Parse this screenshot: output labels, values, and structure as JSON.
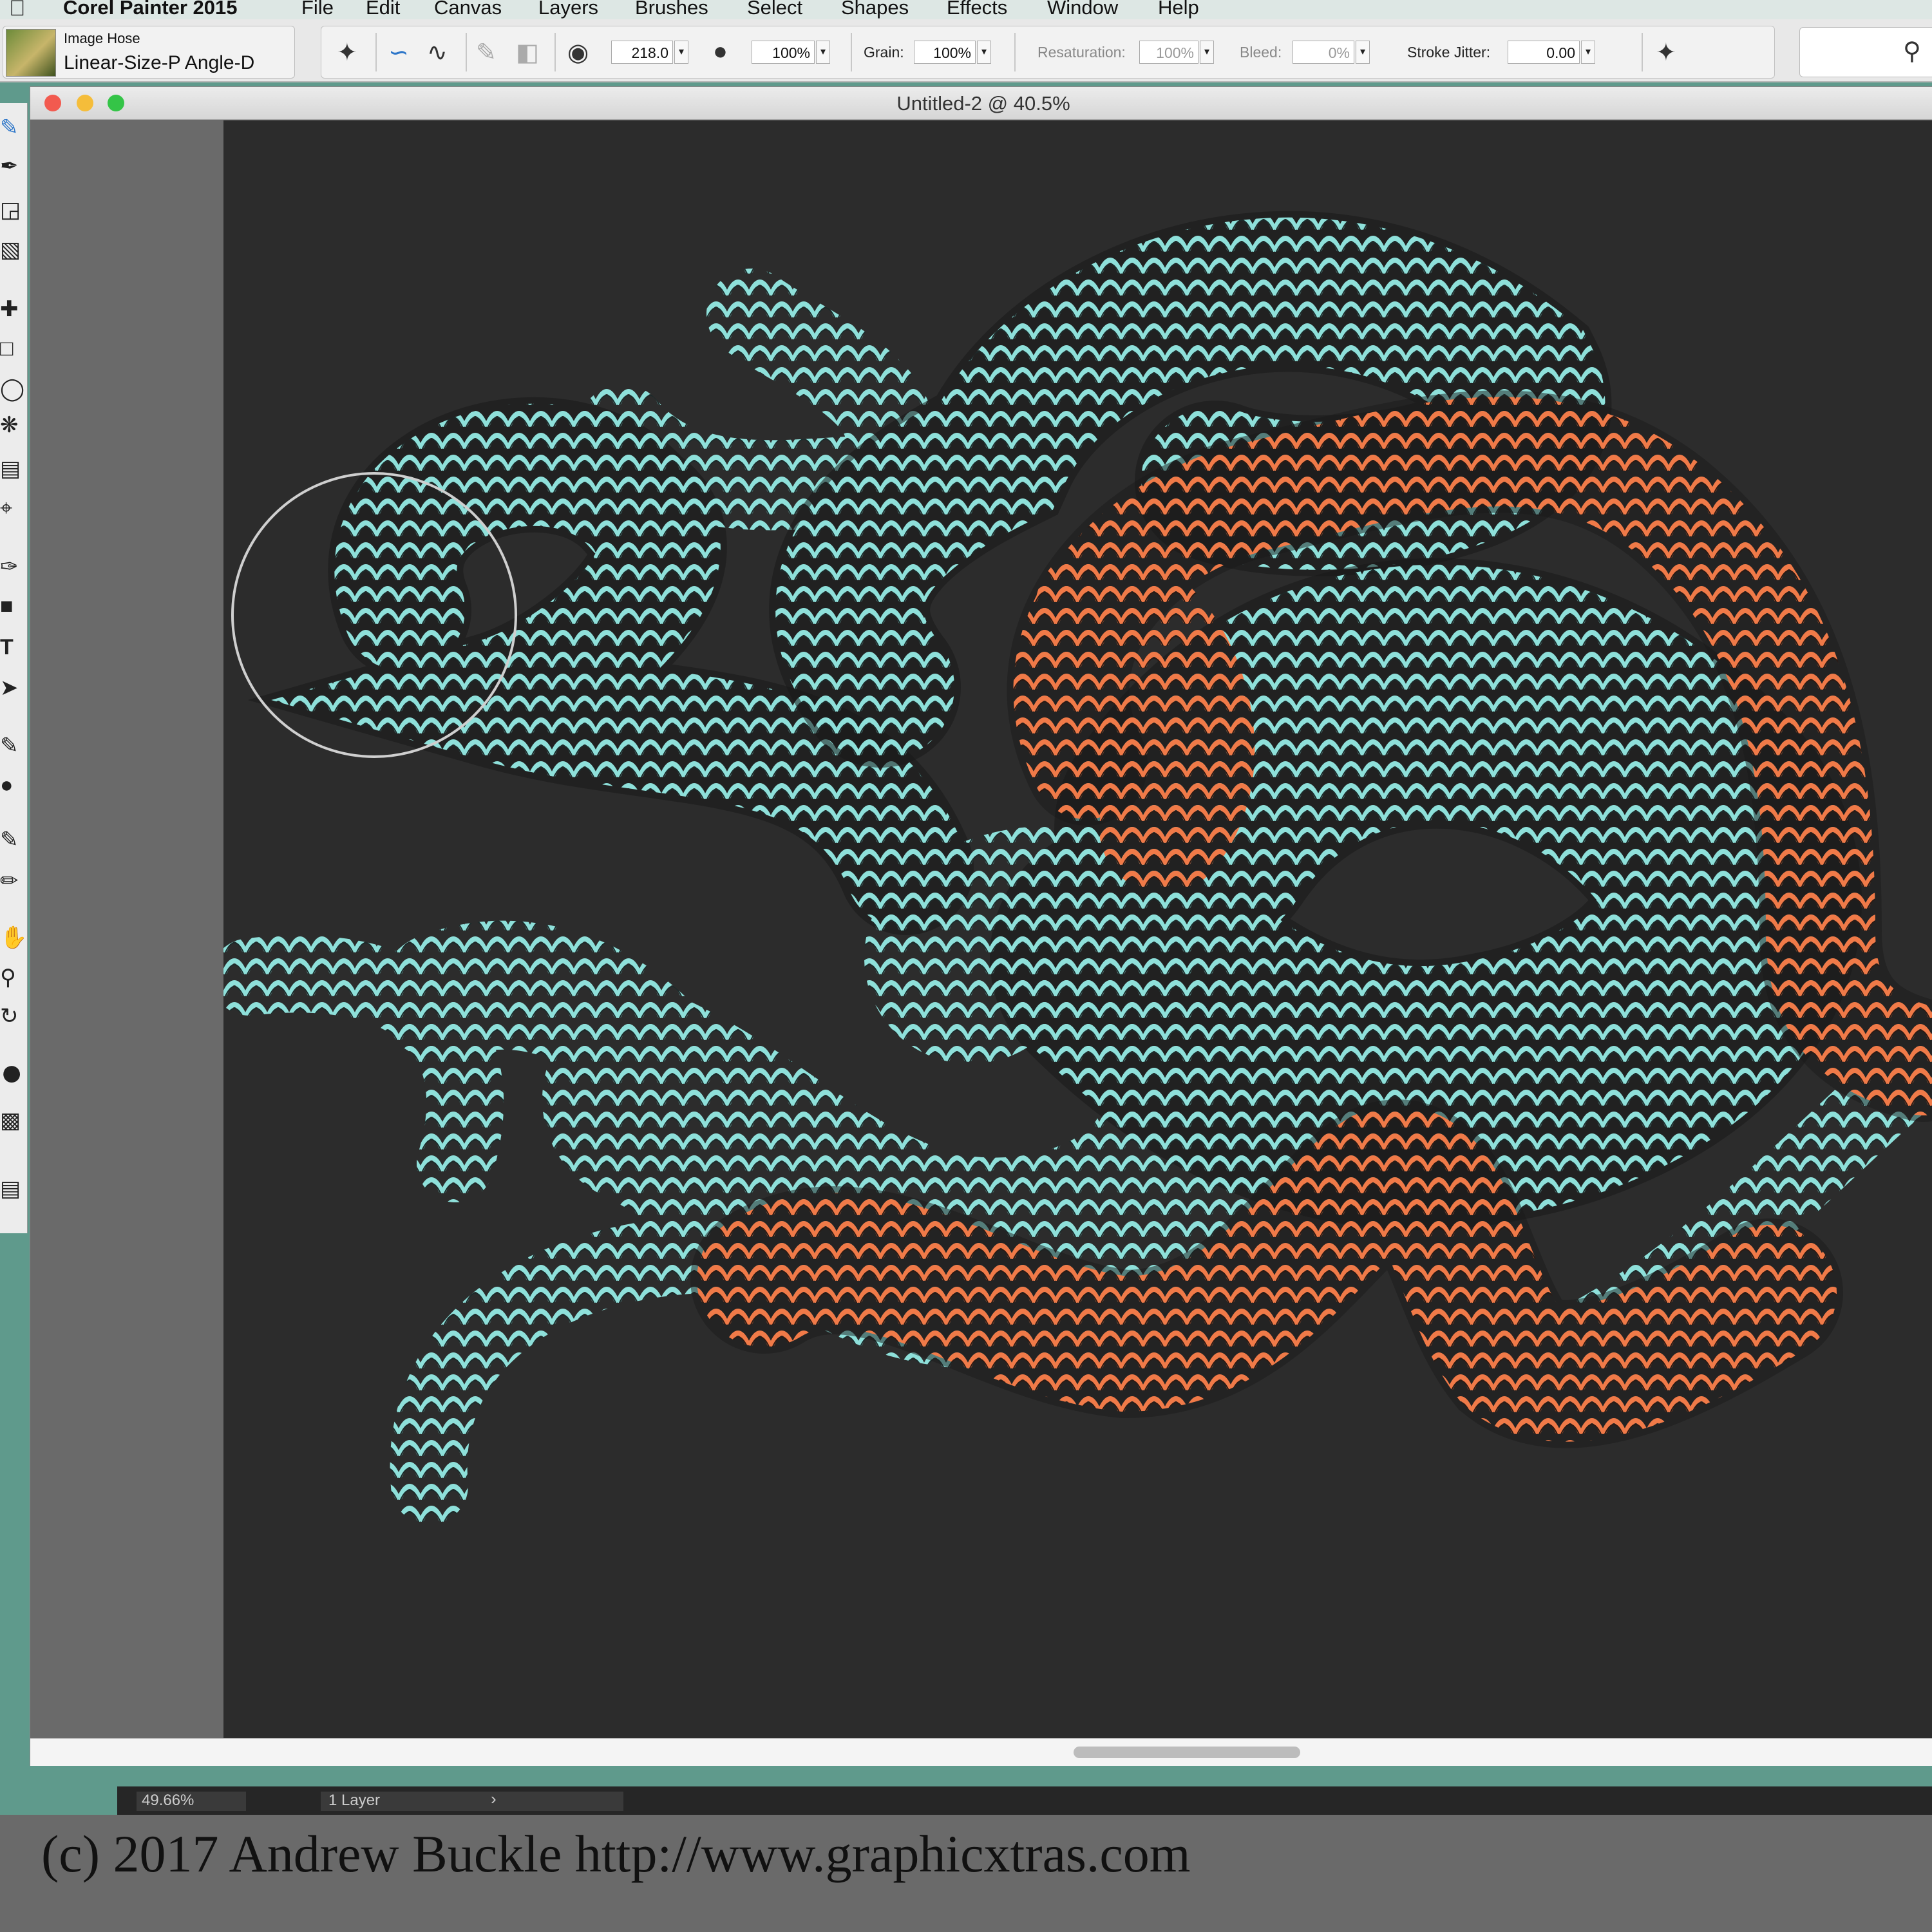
{
  "menubar": {
    "app_name": "Corel Painter 2015",
    "items": [
      "File",
      "Edit",
      "Canvas",
      "Layers",
      "Brushes",
      "Select",
      "Shapes",
      "Effects",
      "Window",
      "Help"
    ]
  },
  "brush": {
    "category": "Image Hose",
    "variant": "Linear-Size-P Angle-D"
  },
  "property_bar": {
    "size_value": "218.0",
    "opacity_value": "100%",
    "grain_label": "Grain:",
    "grain_value": "100%",
    "resaturation_label": "Resaturation:",
    "resaturation_value": "100%",
    "bleed_label": "Bleed:",
    "bleed_value": "0%",
    "stroke_jitter_label": "Stroke Jitter:",
    "stroke_jitter_value": "0.00"
  },
  "document": {
    "title": "Untitled-2 @ 40.5%"
  },
  "status": {
    "zoom": "49.66%",
    "layers": "1 Layer"
  },
  "credit": "(c) 2017 Andrew Buckle http://www.graphicxtras.com",
  "colors": {
    "canvas": "#2c2c2c",
    "teal": "#8ee0da",
    "orange": "#f07a48",
    "desktop": "#5f9a8c"
  },
  "icons": {
    "toolbox": [
      "brush-icon",
      "dropper-icon",
      "paint-bucket-icon",
      "eraser-icon",
      "move-icon",
      "rect-select-icon",
      "lasso-icon",
      "magic-wand-icon",
      "transform-icon",
      "crop-icon",
      "pen-icon",
      "shape-icon",
      "text-icon",
      "pointer-icon",
      "cloner-icon",
      "blender-icon",
      "dodge-icon",
      "hand-icon",
      "magnifier-icon",
      "rotate-icon",
      "color-swatch-icon"
    ]
  }
}
